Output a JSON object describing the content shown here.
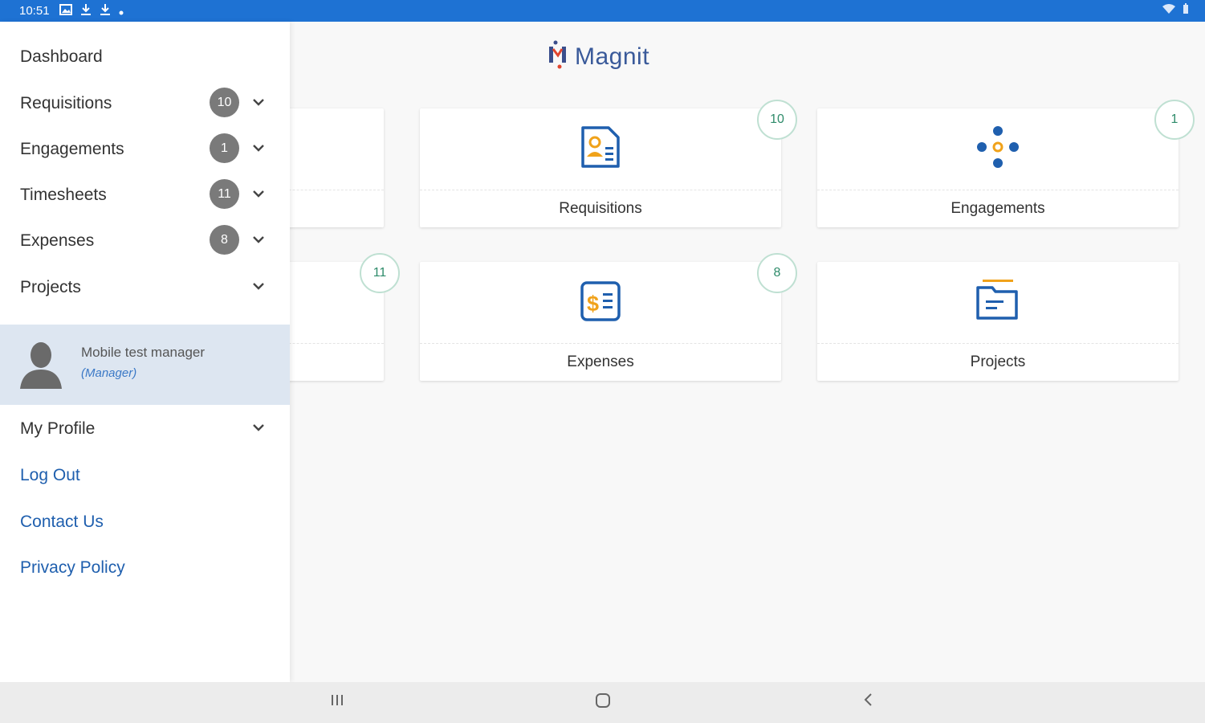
{
  "status_bar": {
    "time": "10:51"
  },
  "brand": {
    "name": "Magnit"
  },
  "dashboard_cards": [
    {
      "label": "Requisitions",
      "count": "10",
      "icon": "requisition-icon"
    },
    {
      "label": "Engagements",
      "count": "1",
      "icon": "engagement-icon"
    },
    {
      "label": "",
      "count": "11",
      "icon": "timesheet-icon"
    },
    {
      "label": "Expenses",
      "count": "8",
      "icon": "expense-icon"
    },
    {
      "label": "Projects",
      "count": "",
      "icon": "project-icon"
    }
  ],
  "drawer": {
    "menu": [
      {
        "label": "Dashboard"
      },
      {
        "label": "Requisitions",
        "count": "10"
      },
      {
        "label": "Engagements",
        "count": "1"
      },
      {
        "label": "Timesheets",
        "count": "11"
      },
      {
        "label": "Expenses",
        "count": "8"
      },
      {
        "label": "Projects"
      }
    ],
    "user": {
      "name": "Mobile test manager",
      "role": "(Manager)"
    },
    "profile": {
      "label": "My Profile"
    },
    "links": [
      {
        "label": "Log Out"
      },
      {
        "label": "Contact Us"
      },
      {
        "label": "Privacy Policy"
      }
    ]
  },
  "colors": {
    "status_bar": "#1e72d3",
    "icon_blue": "#1f5fae",
    "icon_orange": "#f0a21a",
    "badge_border": "#bfe0d2",
    "drawer_count": "#7a7a7a",
    "user_bg": "#dde6f1"
  }
}
